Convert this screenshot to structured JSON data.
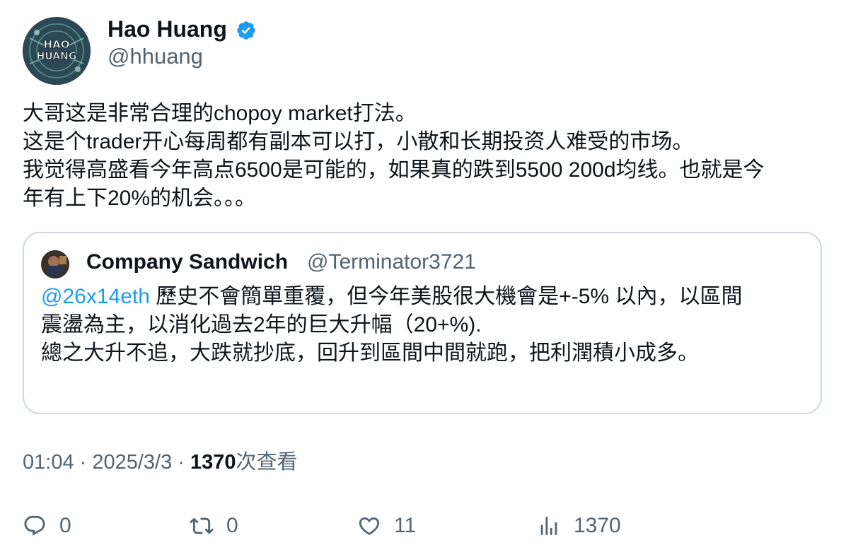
{
  "author": {
    "display_name": "Hao Huang",
    "handle": "@hhuang",
    "verified": true,
    "avatar_text": "HAO HUANG",
    "verified_color": "#1d9bf0"
  },
  "tweet": {
    "lines": [
      "大哥这是非常合理的chopoy market打法。",
      "这是个trader开心每周都有副本可以打，小散和长期投资人难受的市场。",
      "我觉得高盛看今年高点6500是可能的，如果真的跌到5500 200d均线。也就是今",
      "年有上下20%的机会。。。"
    ]
  },
  "quote": {
    "display_name": "Company Sandwich",
    "handle": "@Terminator3721",
    "mention": "@26x14eth",
    "line1_rest": " 歷史不會簡單重覆，但今年美股很大機會是+-5% 以內，以區間",
    "line2": "震盪為主，以消化過去2年的巨大升幅（20+%).",
    "line3": "總之大升不追，大跌就抄底，回升到區間中間就跑，把利潤積小成多。"
  },
  "meta": {
    "time": "01:04",
    "sep1": " · ",
    "date": "2025/3/3",
    "sep2": " · ",
    "views_count": "1370",
    "views_label": "次查看"
  },
  "actions": {
    "reply_count": "0",
    "retweet_count": "0",
    "like_count": "11",
    "views_count": "1370",
    "icon_color": "#536471"
  }
}
